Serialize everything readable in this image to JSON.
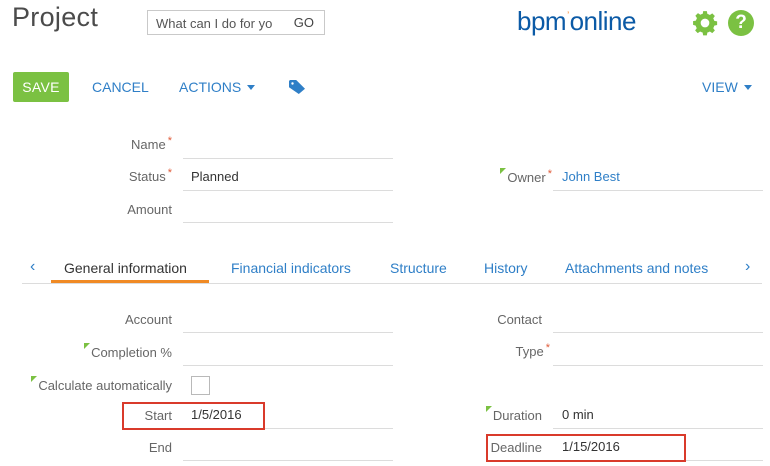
{
  "header": {
    "title": "Project",
    "search_placeholder": "What can I do for yo",
    "search_go": "GO",
    "logo_main": "bpm",
    "logo_mark": "’",
    "logo_tail": "online"
  },
  "toolbar": {
    "save_label": "SAVE",
    "cancel_label": "CANCEL",
    "actions_label": "ACTIONS",
    "view_label": "VIEW"
  },
  "fields": {
    "name_label": "Name",
    "name_value": "",
    "status_label": "Status",
    "status_value": "Planned",
    "amount_label": "Amount",
    "amount_value": "",
    "owner_label": "Owner",
    "owner_value": "John Best"
  },
  "tabs": [
    {
      "label": "General information"
    },
    {
      "label": "Financial indicators"
    },
    {
      "label": "Structure"
    },
    {
      "label": "History"
    },
    {
      "label": "Attachments and notes"
    }
  ],
  "general": {
    "account_label": "Account",
    "contact_label": "Contact",
    "completion_label": "Completion %",
    "type_label": "Type",
    "calc_label": "Calculate automatically",
    "start_label": "Start",
    "start_value": "1/5/2016",
    "duration_label": "Duration",
    "duration_value": "0 min",
    "end_label": "End",
    "deadline_label": "Deadline",
    "deadline_value": "1/15/2016"
  },
  "colors": {
    "accent_green": "#7bc142",
    "link_blue": "#2f7fc7",
    "tab_orange": "#f08a24",
    "highlight_red": "#d93a2b"
  }
}
